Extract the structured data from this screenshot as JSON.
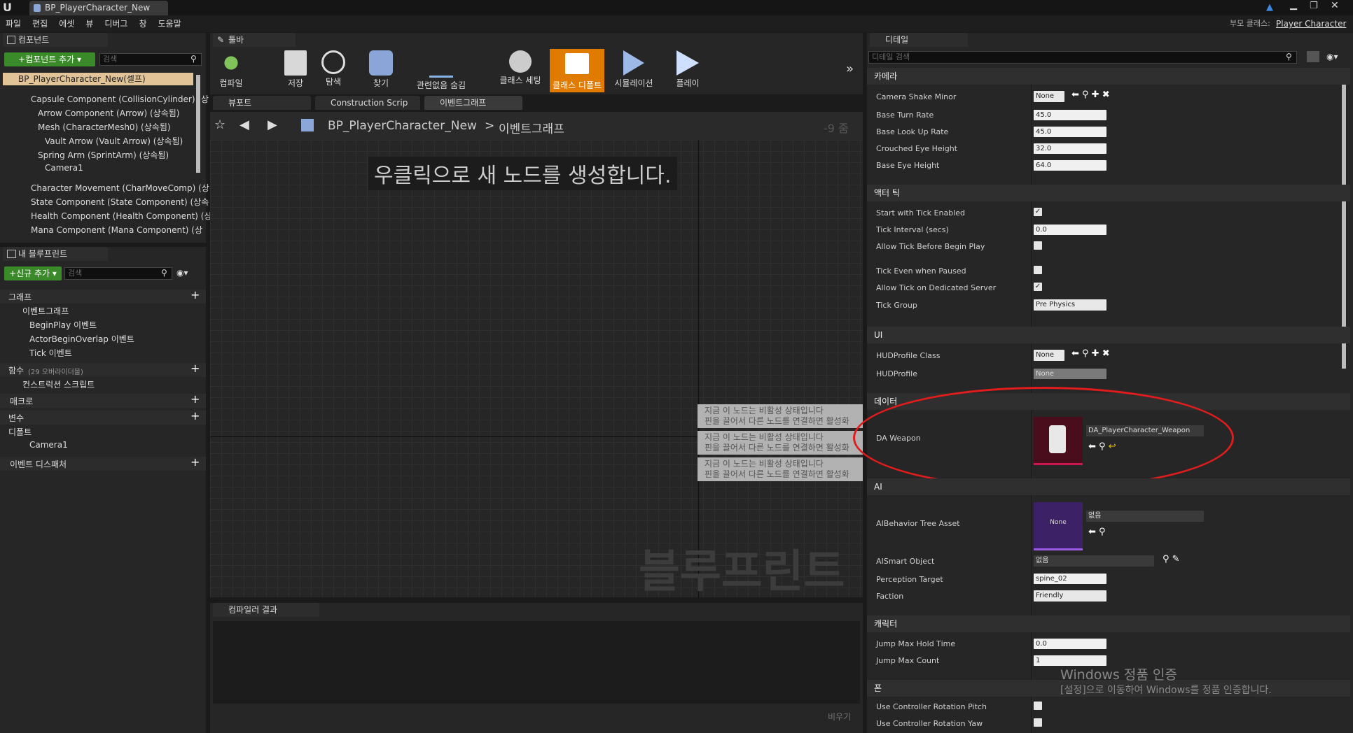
{
  "title_bar": {
    "tab": "BP_PlayerCharacter_New"
  },
  "menu": [
    "파일",
    "편집",
    "에셋",
    "뷰",
    "디버그",
    "창",
    "도움말"
  ],
  "parent_class": {
    "label": "부모 클래스:",
    "value": "Player Character"
  },
  "components": {
    "tab": "컴포넌트",
    "add_button": "+컴포넌트 추가 ▾",
    "search_placeholder": "검색",
    "root": "BP_PlayerCharacter_New(셀프)",
    "items": [
      "Capsule Component (CollisionCylinder) (상",
      "Arrow Component (Arrow) (상속됨)",
      "Mesh (CharacterMesh0) (상속됨)",
      "Vault Arrow (Vault Arrow) (상속됨)",
      "Spring Arm (SprintArm) (상속됨)",
      "Camera1",
      "Character Movement (CharMoveComp) (상",
      "State Component (State Component) (상속",
      "Health Component (Health Component) (상",
      "Mana Component (Mana Component) (상"
    ]
  },
  "my_blueprint": {
    "tab": "내 블루프린트",
    "add_button": "+신규 추가 ▾",
    "search_placeholder": "검색",
    "graph": "그래프",
    "event_graph": "이벤트그래프",
    "events": [
      "BeginPlay 이벤트",
      "ActorBeginOverlap 이벤트",
      "Tick 이벤트"
    ],
    "functions": "함수",
    "functions_note": "(29 오버라이더블)",
    "construction_script": "컨스트럭션 스크립트",
    "macros": "매크로",
    "variables": "변수",
    "defaults": "디폴트",
    "camera_var": "Camera1",
    "dispatchers": "이벤트 디스패처"
  },
  "toolbar": {
    "tab": "툴바",
    "buttons": [
      "컴파일",
      "저장",
      "탐색",
      "찾기",
      "관련없음 숨김",
      "클래스 세팅",
      "클래스 디폴트",
      "시뮬레이션",
      "플레이"
    ]
  },
  "graph_tabs": [
    "뷰포트",
    "Construction Scrip",
    "이벤트그래프"
  ],
  "breadcrumb": {
    "bp": "BP_PlayerCharacter_New",
    "sep": ">",
    "graph": "이벤트그래프",
    "zoom": "-9 줌"
  },
  "graph": {
    "hint": "우클릭으로 새 노드를 생성합니다.",
    "watermark": "블루프린트",
    "disabled_nodes": [
      {
        "line1": "지금 이 노드는 비활성 상태입니다",
        "line2": "핀을 끌어서 다른 노드를 연결하면 활성화"
      },
      {
        "line1": "지금 이 노드는 비활성 상태입니다",
        "line2": "핀을 끌어서 다른 노드를 연결하면 활성화"
      },
      {
        "line1": "지금 이 노드는 비활성 상태입니다",
        "line2": "핀을 끌어서 다른 노드를 연결하면 활성화"
      }
    ]
  },
  "compiler": {
    "tab": "컴파일러 결과",
    "clear": "비우기"
  },
  "details": {
    "tab": "디테일",
    "search_placeholder": "디테일 검색",
    "camera": {
      "header": "카메라",
      "shake_label": "Camera Shake Minor",
      "shake_value": "None",
      "turn_label": "Base Turn Rate",
      "turn_value": "45.0",
      "look_label": "Base Look Up Rate",
      "look_value": "45.0",
      "crouch_label": "Crouched Eye Height",
      "crouch_value": "32.0",
      "eye_label": "Base Eye Height",
      "eye_value": "64.0"
    },
    "tick": {
      "header": "액터 틱",
      "start_label": "Start with Tick Enabled",
      "start_checked": "✓",
      "interval_label": "Tick Interval (secs)",
      "interval_value": "0.0",
      "before_label": "Allow Tick Before Begin Play",
      "paused_label": "Tick Even when Paused",
      "server_label": "Allow Tick on Dedicated Server",
      "server_checked": "✓",
      "group_label": "Tick Group",
      "group_value": "Pre Physics"
    },
    "ui": {
      "header": "UI",
      "class_label": "HUDProfile Class",
      "class_value": "None",
      "profile_label": "HUDProfile",
      "profile_value": "None"
    },
    "data": {
      "header": "데이터",
      "weapon_label": "DA Weapon",
      "weapon_value": "DA_PlayerCharacter_Weapon"
    },
    "ai": {
      "header": "AI",
      "tree_label": "AIBehavior Tree Asset",
      "tree_thumb": "None",
      "tree_value": "없음",
      "smart_label": "AISmart Object",
      "smart_value": "없음",
      "perception_label": "Perception Target",
      "perception_value": "spine_02",
      "faction_label": "Faction",
      "faction_value": "Friendly"
    },
    "character": {
      "header": "캐릭터",
      "hold_label": "Jump Max Hold Time",
      "hold_value": "0.0",
      "count_label": "Jump Max Count",
      "count_value": "1"
    },
    "pawn": {
      "header": "폰",
      "pitch_label": "Use Controller Rotation Pitch",
      "yaw_label": "Use Controller Rotation Yaw"
    }
  },
  "windows_watermark": {
    "line1": "Windows 정품 인증",
    "line2": "[설정]으로 이동하여 Windows를 정품 인증합니다."
  },
  "colors": {
    "accent_orange": "#e07b00",
    "green": "#3b8a2a",
    "highlight_red": "#e01c1c"
  }
}
